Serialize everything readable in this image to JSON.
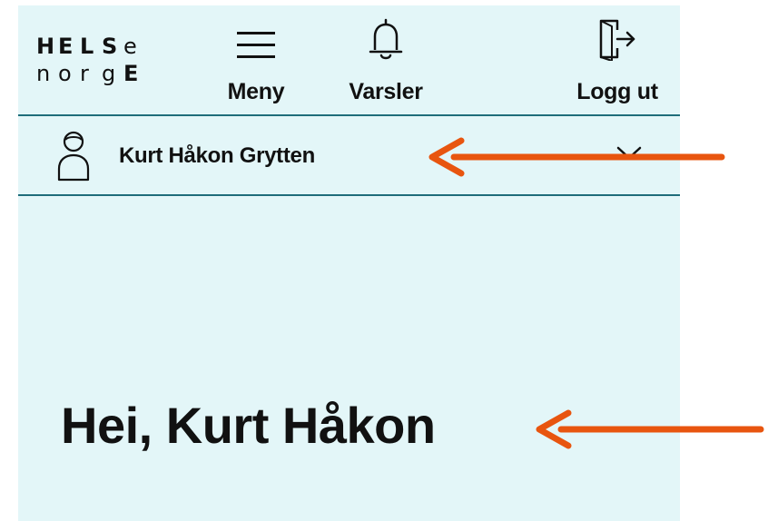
{
  "logo": {
    "row1": [
      "H",
      "E",
      "L",
      "S",
      "e"
    ],
    "row2": [
      "n",
      "o",
      "r",
      "g",
      "E"
    ]
  },
  "nav": {
    "menu_label": "Meny",
    "notifications_label": "Varsler",
    "logout_label": "Logg ut"
  },
  "profile": {
    "name": "Kurt Håkon Grytten"
  },
  "greeting": "Hei, Kurt Håkon",
  "colors": {
    "background": "#e3f6f8",
    "divider": "#1f6d7a",
    "annotation_arrow": "#e8550f"
  },
  "icons": {
    "menu": "hamburger-icon",
    "notifications": "bell-icon",
    "logout": "logout-icon",
    "profile": "person-icon",
    "expand": "chevron-down-icon"
  }
}
